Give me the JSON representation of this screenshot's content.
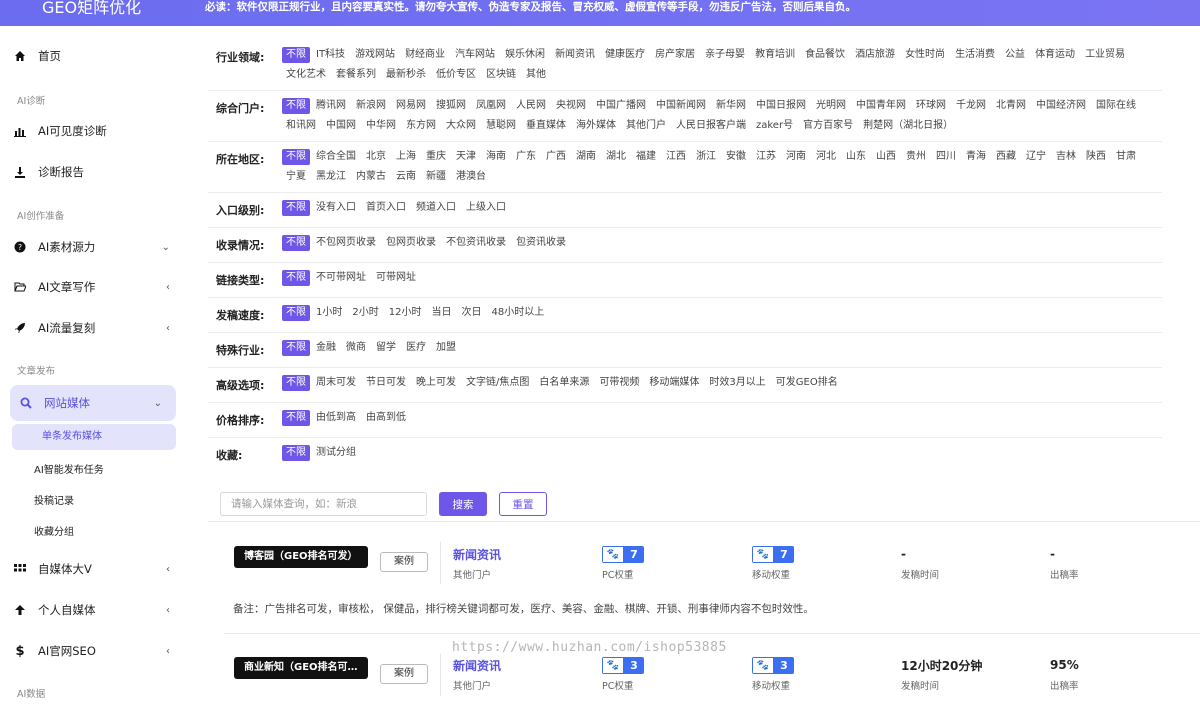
{
  "header": {
    "logo": "GEO矩阵优化",
    "notice": "必读：软件仅限正规行业，且内容要真实性。请勿夸大宣传、伪造专家及报告、冒充权威、虚假宣传等手段，勿违反广告法，否则后果自负。"
  },
  "sidebar": {
    "home": "首页",
    "section_ai_diag": "AI诊断",
    "visibility": "AI可见度诊断",
    "report": "诊断报告",
    "section_ai_prep": "AI创作准备",
    "material": "AI素材源力",
    "article": "AI文章写作",
    "traffic": "AI流量复刻",
    "section_publish": "文章发布",
    "site_media": "网站媒体",
    "sub_items": [
      "单条发布媒体",
      "AI智能发布任务",
      "投稿记录",
      "收藏分组"
    ],
    "self_media_v": "自媒体大V",
    "personal_media": "个人自媒体",
    "official_seo": "AI官网SEO",
    "section_ai_data": "AI数据"
  },
  "filters": [
    {
      "title": "行业领域:",
      "options": [
        "不限",
        "IT科技",
        "游戏网站",
        "财经商业",
        "汽车网站",
        "娱乐休闲",
        "新闻资讯",
        "健康医疗",
        "房产家居",
        "亲子母婴",
        "教育培训",
        "食品餐饮",
        "酒店旅游",
        "女性时尚",
        "生活消费",
        "公益",
        "体育运动",
        "工业贸易",
        "文化艺术",
        "套餐系列",
        "最新秒杀",
        "低价专区",
        "区块链",
        "其他"
      ]
    },
    {
      "title": "综合门户:",
      "options": [
        "不限",
        "腾讯网",
        "新浪网",
        "网易网",
        "搜狐网",
        "凤凰网",
        "人民网",
        "央视网",
        "中国广播网",
        "中国新闻网",
        "新华网",
        "中国日报网",
        "光明网",
        "中国青年网",
        "环球网",
        "千龙网",
        "北青网",
        "中国经济网",
        "国际在线",
        "和讯网",
        "中国网",
        "中华网",
        "东方网",
        "大众网",
        "慧聪网",
        "垂直媒体",
        "海外媒体",
        "其他门户",
        "人民日报客户端",
        "zaker号",
        "官方百家号",
        "荆楚网（湖北日报）"
      ]
    },
    {
      "title": "所在地区:",
      "options": [
        "不限",
        "综合全国",
        "北京",
        "上海",
        "重庆",
        "天津",
        "海南",
        "广东",
        "广西",
        "湖南",
        "湖北",
        "福建",
        "江西",
        "浙江",
        "安徽",
        "江苏",
        "河南",
        "河北",
        "山东",
        "山西",
        "贵州",
        "四川",
        "青海",
        "西藏",
        "辽宁",
        "吉林",
        "陕西",
        "甘肃",
        "宁夏",
        "黑龙江",
        "内蒙古",
        "云南",
        "新疆",
        "港澳台"
      ]
    },
    {
      "title": "入口级别:",
      "options": [
        "不限",
        "没有入口",
        "首页入口",
        "频道入口",
        "上级入口"
      ]
    },
    {
      "title": "收录情况:",
      "options": [
        "不限",
        "不包网页收录",
        "包网页收录",
        "不包资讯收录",
        "包资讯收录"
      ]
    },
    {
      "title": "链接类型:",
      "options": [
        "不限",
        "不可带网址",
        "可带网址"
      ]
    },
    {
      "title": "发稿速度:",
      "options": [
        "不限",
        "1小时",
        "2小时",
        "12小时",
        "当日",
        "次日",
        "48小时以上"
      ]
    },
    {
      "title": "特殊行业:",
      "options": [
        "不限",
        "金融",
        "微商",
        "留学",
        "医疗",
        "加盟"
      ]
    },
    {
      "title": "高级选项:",
      "options": [
        "不限",
        "周末可发",
        "节日可发",
        "晚上可发",
        "文字链/焦点图",
        "白名单来源",
        "可带视频",
        "移动端媒体",
        "时效3月以上",
        "可发GEO排名"
      ]
    },
    {
      "title": "价格排序:",
      "options": [
        "不限",
        "由低到高",
        "由高到低"
      ]
    },
    {
      "title": "收藏:",
      "options": [
        "不限",
        "测试分组"
      ]
    }
  ],
  "search": {
    "placeholder": "请输入媒体查询，如：新浪",
    "search_label": "搜索",
    "reset_label": "重置"
  },
  "results": [
    {
      "name": "博客园（GEO排名可发）",
      "case_label": "案例",
      "category": "新闻资讯",
      "category_sub": "其他门户",
      "pc_weight": "7",
      "pc_label": "PC权重",
      "mobile_weight": "7",
      "mobile_label": "移动权重",
      "publish_time": "-",
      "publish_time_label": "发稿时间",
      "rate": "-",
      "rate_label": "出稿率",
      "remark": "备注：广告排名可发，审核松， 保健品，排行榜关键词都可发，医疗、美容、金融、棋牌、开锁、刑事律师内容不包时效性。"
    },
    {
      "name": "商业新知（GEO排名可…",
      "case_label": "案例",
      "category": "新闻资讯",
      "category_sub": "其他门户",
      "pc_weight": "3",
      "pc_label": "PC权重",
      "mobile_weight": "3",
      "mobile_label": "移动权重",
      "publish_time": "12小时20分钟",
      "publish_time_label": "发稿时间",
      "rate": "95%",
      "rate_label": "出稿率"
    }
  ],
  "watermark": "https://www.huzhan.com/ishop53885"
}
